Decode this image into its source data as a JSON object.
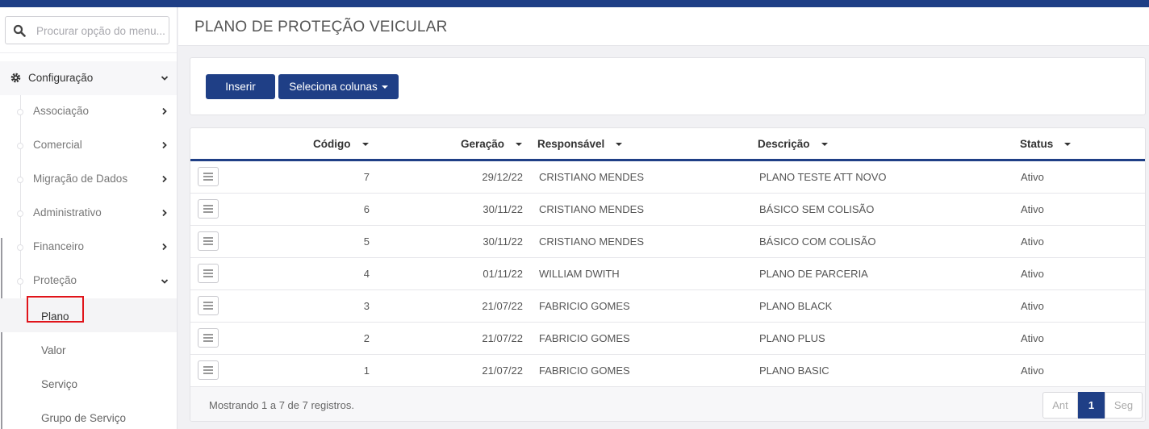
{
  "sidebar": {
    "search_placeholder": "Procurar opção do menu...",
    "config_label": "Configuração",
    "items": [
      {
        "label": "Associação"
      },
      {
        "label": "Comercial"
      },
      {
        "label": "Migração de Dados"
      },
      {
        "label": "Administrativo"
      },
      {
        "label": "Financeiro"
      },
      {
        "label": "Proteção"
      }
    ],
    "sub_items": [
      {
        "label": "Plano"
      },
      {
        "label": "Valor"
      },
      {
        "label": "Serviço"
      },
      {
        "label": "Grupo de Serviço"
      }
    ]
  },
  "page": {
    "title": "PLANO DE PROTEÇÃO VEICULAR"
  },
  "toolbar": {
    "insert_label": "Inserir",
    "columns_label": "Seleciona colunas"
  },
  "table": {
    "columns": [
      "Código",
      "Geração",
      "Responsável",
      "Descrição",
      "Status"
    ],
    "rows": [
      {
        "codigo": "7",
        "geracao": "29/12/22",
        "responsavel": "CRISTIANO MENDES",
        "descricao": "PLANO TESTE ATT NOVO",
        "status": "Ativo"
      },
      {
        "codigo": "6",
        "geracao": "30/11/22",
        "responsavel": "CRISTIANO MENDES",
        "descricao": "BÁSICO SEM COLISÃO",
        "status": "Ativo"
      },
      {
        "codigo": "5",
        "geracao": "30/11/22",
        "responsavel": "CRISTIANO MENDES",
        "descricao": "BÁSICO COM COLISÃO",
        "status": "Ativo"
      },
      {
        "codigo": "4",
        "geracao": "01/11/22",
        "responsavel": "WILLIAM DWITH",
        "descricao": "PLANO DE PARCERIA",
        "status": "Ativo"
      },
      {
        "codigo": "3",
        "geracao": "21/07/22",
        "responsavel": "FABRICIO GOMES",
        "descricao": "PLANO BLACK",
        "status": "Ativo"
      },
      {
        "codigo": "2",
        "geracao": "21/07/22",
        "responsavel": "FABRICIO GOMES",
        "descricao": "PLANO PLUS",
        "status": "Ativo"
      },
      {
        "codigo": "1",
        "geracao": "21/07/22",
        "responsavel": "FABRICIO GOMES",
        "descricao": "PLANO BASIC",
        "status": "Ativo"
      }
    ],
    "footer_info": "Mostrando 1 a 7 de 7 registros.",
    "pager": {
      "prev": "Ant",
      "current": "1",
      "next": "Seg"
    }
  },
  "colors": {
    "accent": "#1f3f86",
    "highlight": "#e0141a"
  }
}
